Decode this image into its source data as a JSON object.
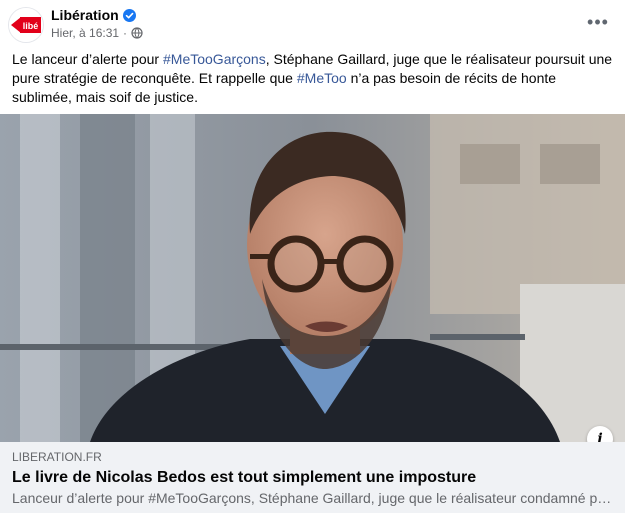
{
  "header": {
    "page_name": "Libération",
    "timestamp": "Hier, à 16:31",
    "separator": "·",
    "more_label": "•••",
    "logo_text": "libé"
  },
  "post": {
    "text_parts": {
      "p1": "Le lanceur d’alerte pour ",
      "tag1": "#MeTooGarçons",
      "p2": ", Stéphane Gaillard, juge que le réalisateur poursuit une pure stratégie de reconquête. Et rappelle que ",
      "tag2": "#MeToo",
      "p3": " n’a pas besoin de récits de honte sublimée, mais soif de justice."
    }
  },
  "link_preview": {
    "domain": "LIBERATION.FR",
    "title": "Le livre de Nicolas Bedos est tout simplement une imposture",
    "description": "Lanceur d’alerte pour #MeTooGarçons, Stéphane Gaillard, juge que le réalisateur condamné pour ...",
    "info_label": "i"
  },
  "colors": {
    "accent_link": "#385898",
    "brand_red": "#e2001a",
    "verified_blue": "#1877f2",
    "secondary_text": "#65676b",
    "card_bg": "#f0f2f5"
  },
  "icons": {
    "verified": "verified-badge-icon",
    "privacy": "globe-icon",
    "more": "more-options-icon",
    "info": "info-icon"
  }
}
